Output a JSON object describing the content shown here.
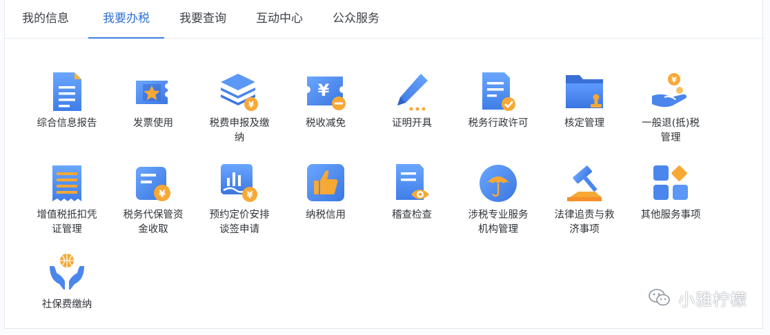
{
  "tabs": [
    {
      "label": "我的信息",
      "active": false
    },
    {
      "label": "我要办税",
      "active": true
    },
    {
      "label": "我要查询",
      "active": false
    },
    {
      "label": "互动中心",
      "active": false
    },
    {
      "label": "公众服务",
      "active": false
    }
  ],
  "services": [
    {
      "label": "综合信息报告",
      "icon": "document-report-icon"
    },
    {
      "label": "发票使用",
      "icon": "invoice-star-icon"
    },
    {
      "label": "税费申报及缴纳",
      "icon": "stacked-layers-yen-icon"
    },
    {
      "label": "税收减免",
      "icon": "yen-ticket-minus-icon"
    },
    {
      "label": "证明开具",
      "icon": "pen-icon"
    },
    {
      "label": "税务行政许可",
      "icon": "document-check-icon"
    },
    {
      "label": "核定管理",
      "icon": "folder-stamp-icon"
    },
    {
      "label": "一般退(抵)税管理",
      "icon": "hand-coin-icon"
    },
    {
      "label": "增值税抵扣凭证管理",
      "icon": "receipt-icon"
    },
    {
      "label": "税务代保管资金收取",
      "icon": "card-yen-icon"
    },
    {
      "label": "预约定价安排谈签申请",
      "icon": "chart-yen-icon"
    },
    {
      "label": "纳税信用",
      "icon": "thumbs-up-icon"
    },
    {
      "label": "稽查检查",
      "icon": "document-eye-icon"
    },
    {
      "label": "涉税专业服务机构管理",
      "icon": "umbrella-icon"
    },
    {
      "label": "法律追责与救济事项",
      "icon": "gavel-icon"
    },
    {
      "label": "其他服务事项",
      "icon": "grid-apps-icon"
    },
    {
      "label": "社保费缴纳",
      "icon": "hands-globe-icon"
    }
  ],
  "watermark": {
    "text": "小雅柠檬",
    "icon": "wechat-icon"
  },
  "colors": {
    "accent": "#3b7fe0",
    "blue": "#4a8cf0",
    "orange": "#f7a835",
    "text": "#2f3338"
  }
}
